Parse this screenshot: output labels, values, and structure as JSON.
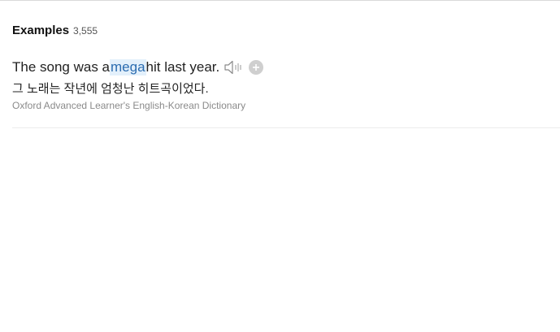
{
  "examples": {
    "title": "Examples",
    "count": "3,555"
  },
  "example": {
    "sentence_before": "The song was a ",
    "sentence_highlight": "mega",
    "sentence_after": " hit last year.",
    "translation": "그 노래는 작년에 엄청난 히트곡이었다.",
    "source": "Oxford Advanced Learner's English-Korean Dictionary",
    "icons": [
      "speaker-icon",
      "plus-icon"
    ]
  }
}
